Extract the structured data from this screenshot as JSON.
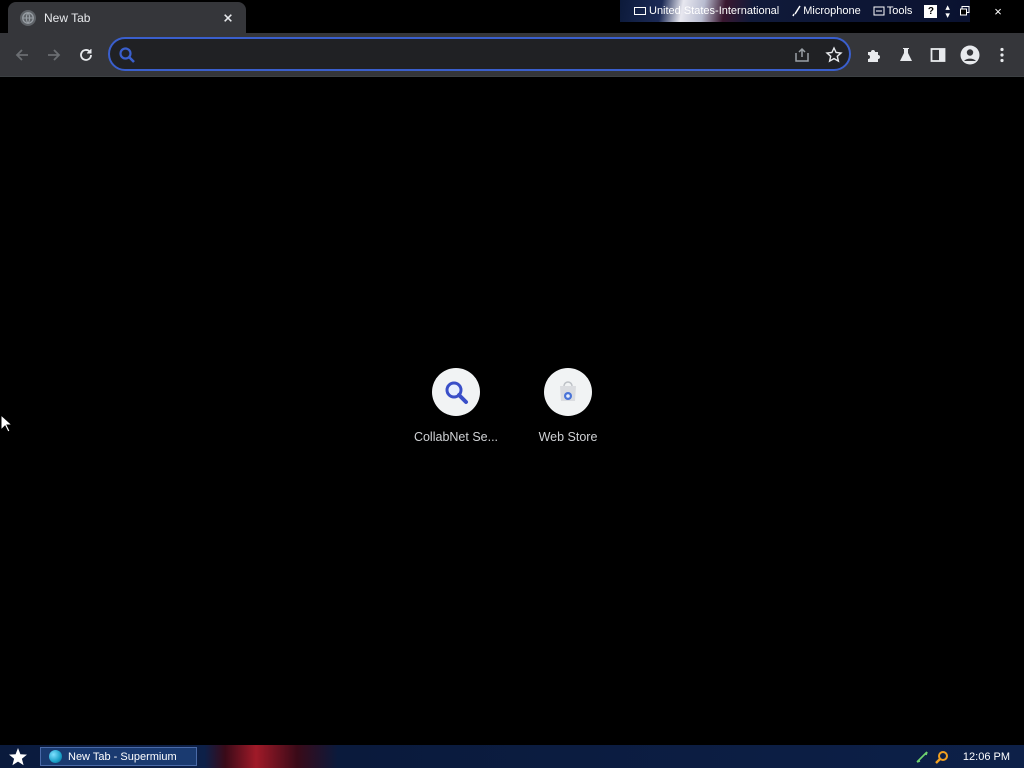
{
  "tab": {
    "title": "New Tab",
    "favicon": "globe-icon",
    "close_icon": "close-icon"
  },
  "language_bar": {
    "language": "United States-International",
    "microphone": "Microphone",
    "tools": "Tools",
    "help": "?"
  },
  "window_controls": {
    "restore": "restore-icon",
    "close": "×"
  },
  "toolbar": {
    "back": "back-arrow-icon",
    "forward": "forward-arrow-icon",
    "reload": "reload-icon",
    "omnibox": {
      "value": "",
      "placeholder": ""
    },
    "share": "share-icon",
    "bookmark": "star-icon",
    "extensions": "puzzle-icon",
    "labs": "flask-icon",
    "side_panel": "side-panel-icon",
    "profile": "avatar-icon",
    "menu": "kebab-menu-icon"
  },
  "shortcuts": [
    {
      "label": "CollabNet Se...",
      "icon": "search-icon"
    },
    {
      "label": "Web Store",
      "icon": "web-store-icon"
    }
  ],
  "taskbar": {
    "start": "star-icon",
    "window_button": "New Tab - Supermium",
    "clock": "12:06 PM"
  },
  "colors": {
    "background": "#000000",
    "toolbar": "#35363a",
    "omnibox_border": "#3a5fcd",
    "search_icon": "#3a5fcd"
  }
}
